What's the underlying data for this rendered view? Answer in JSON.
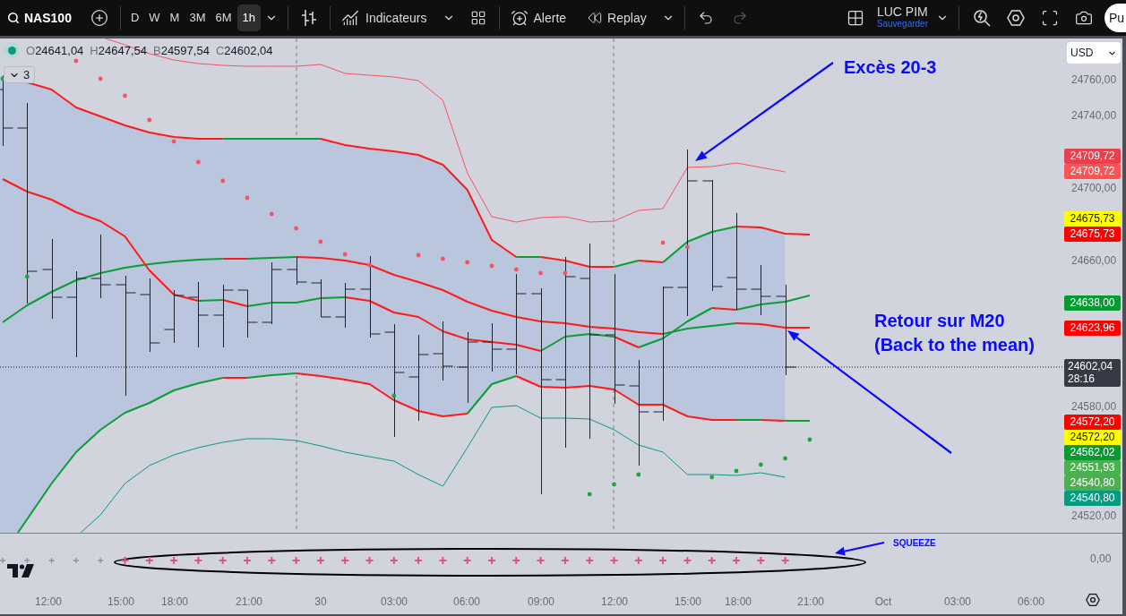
{
  "toolbar": {
    "symbol": "NAS100",
    "intervals": [
      {
        "label": "D",
        "selected": false
      },
      {
        "label": "W",
        "selected": false
      },
      {
        "label": "M",
        "selected": false
      },
      {
        "label": "3M",
        "selected": false
      },
      {
        "label": "6M",
        "selected": false
      },
      {
        "label": "1h",
        "selected": true
      }
    ],
    "indicators": "Indicateurs",
    "alert": "Alerte",
    "replay": "Replay",
    "undo": {
      "disabled": false
    },
    "redo": {
      "disabled": true
    },
    "layout": {
      "name": "LUC PIM",
      "status": "Sauvegarder"
    },
    "publish": "Pu"
  },
  "legend": {
    "values": [
      {
        "letter": "O",
        "value": "24641,04"
      },
      {
        "letter": "H",
        "value": "24647,54"
      },
      {
        "letter": "B",
        "value": "24597,54"
      },
      {
        "letter": "C",
        "value": "24602,04"
      }
    ],
    "collapsed_count": "3"
  },
  "annotations": [
    {
      "lines": [
        "Excès 20-3"
      ]
    },
    {
      "lines": [
        "Retour sur M20",
        "(Back to the mean)"
      ]
    }
  ],
  "price_axis": {
    "currency": "USD",
    "ticks": [
      "24760,00",
      "24740,00",
      "24700,00",
      "24660,00",
      "24580,00",
      "24520,00"
    ],
    "tags": [
      {
        "kind": "level",
        "value": "24709,72",
        "color": "#e8404f"
      },
      {
        "kind": "level",
        "value": "24709,72",
        "color": "#ff5252"
      },
      {
        "kind": "level",
        "value": "24675,73",
        "color": "#ffff00"
      },
      {
        "kind": "level",
        "value": "24675,73",
        "color": "#ff0000"
      },
      {
        "kind": "level",
        "value": "24638,00",
        "color": "#089a32"
      },
      {
        "kind": "level",
        "value": "24623,96",
        "color": "#ff0000"
      },
      {
        "kind": "current",
        "value": "24602,04",
        "countdown": "28:16",
        "color": "#363a45"
      },
      {
        "kind": "level",
        "value": "24572,20",
        "color": "#ff0000"
      },
      {
        "kind": "level",
        "value": "24572,20",
        "color": "#ffff00"
      },
      {
        "kind": "level",
        "value": "24562,02",
        "color": "#089a32"
      },
      {
        "kind": "level",
        "value": "24551,93",
        "color": "#4caf50"
      },
      {
        "kind": "level",
        "value": "24540,80",
        "color": "#4caf50"
      },
      {
        "kind": "level",
        "value": "24540,80",
        "color": "#089981"
      }
    ]
  },
  "squeeze_pane": {
    "label": "SQUEEZE",
    "axis_value": "0,00"
  },
  "time_axis": {
    "labels": [
      "12:00",
      "15:00",
      "18:00",
      "21:00",
      "30",
      "03:00",
      "06:00",
      "09:00",
      "12:00",
      "15:00",
      "18:00",
      "21:00",
      "Oct",
      "03:00",
      "06:00"
    ]
  }
}
